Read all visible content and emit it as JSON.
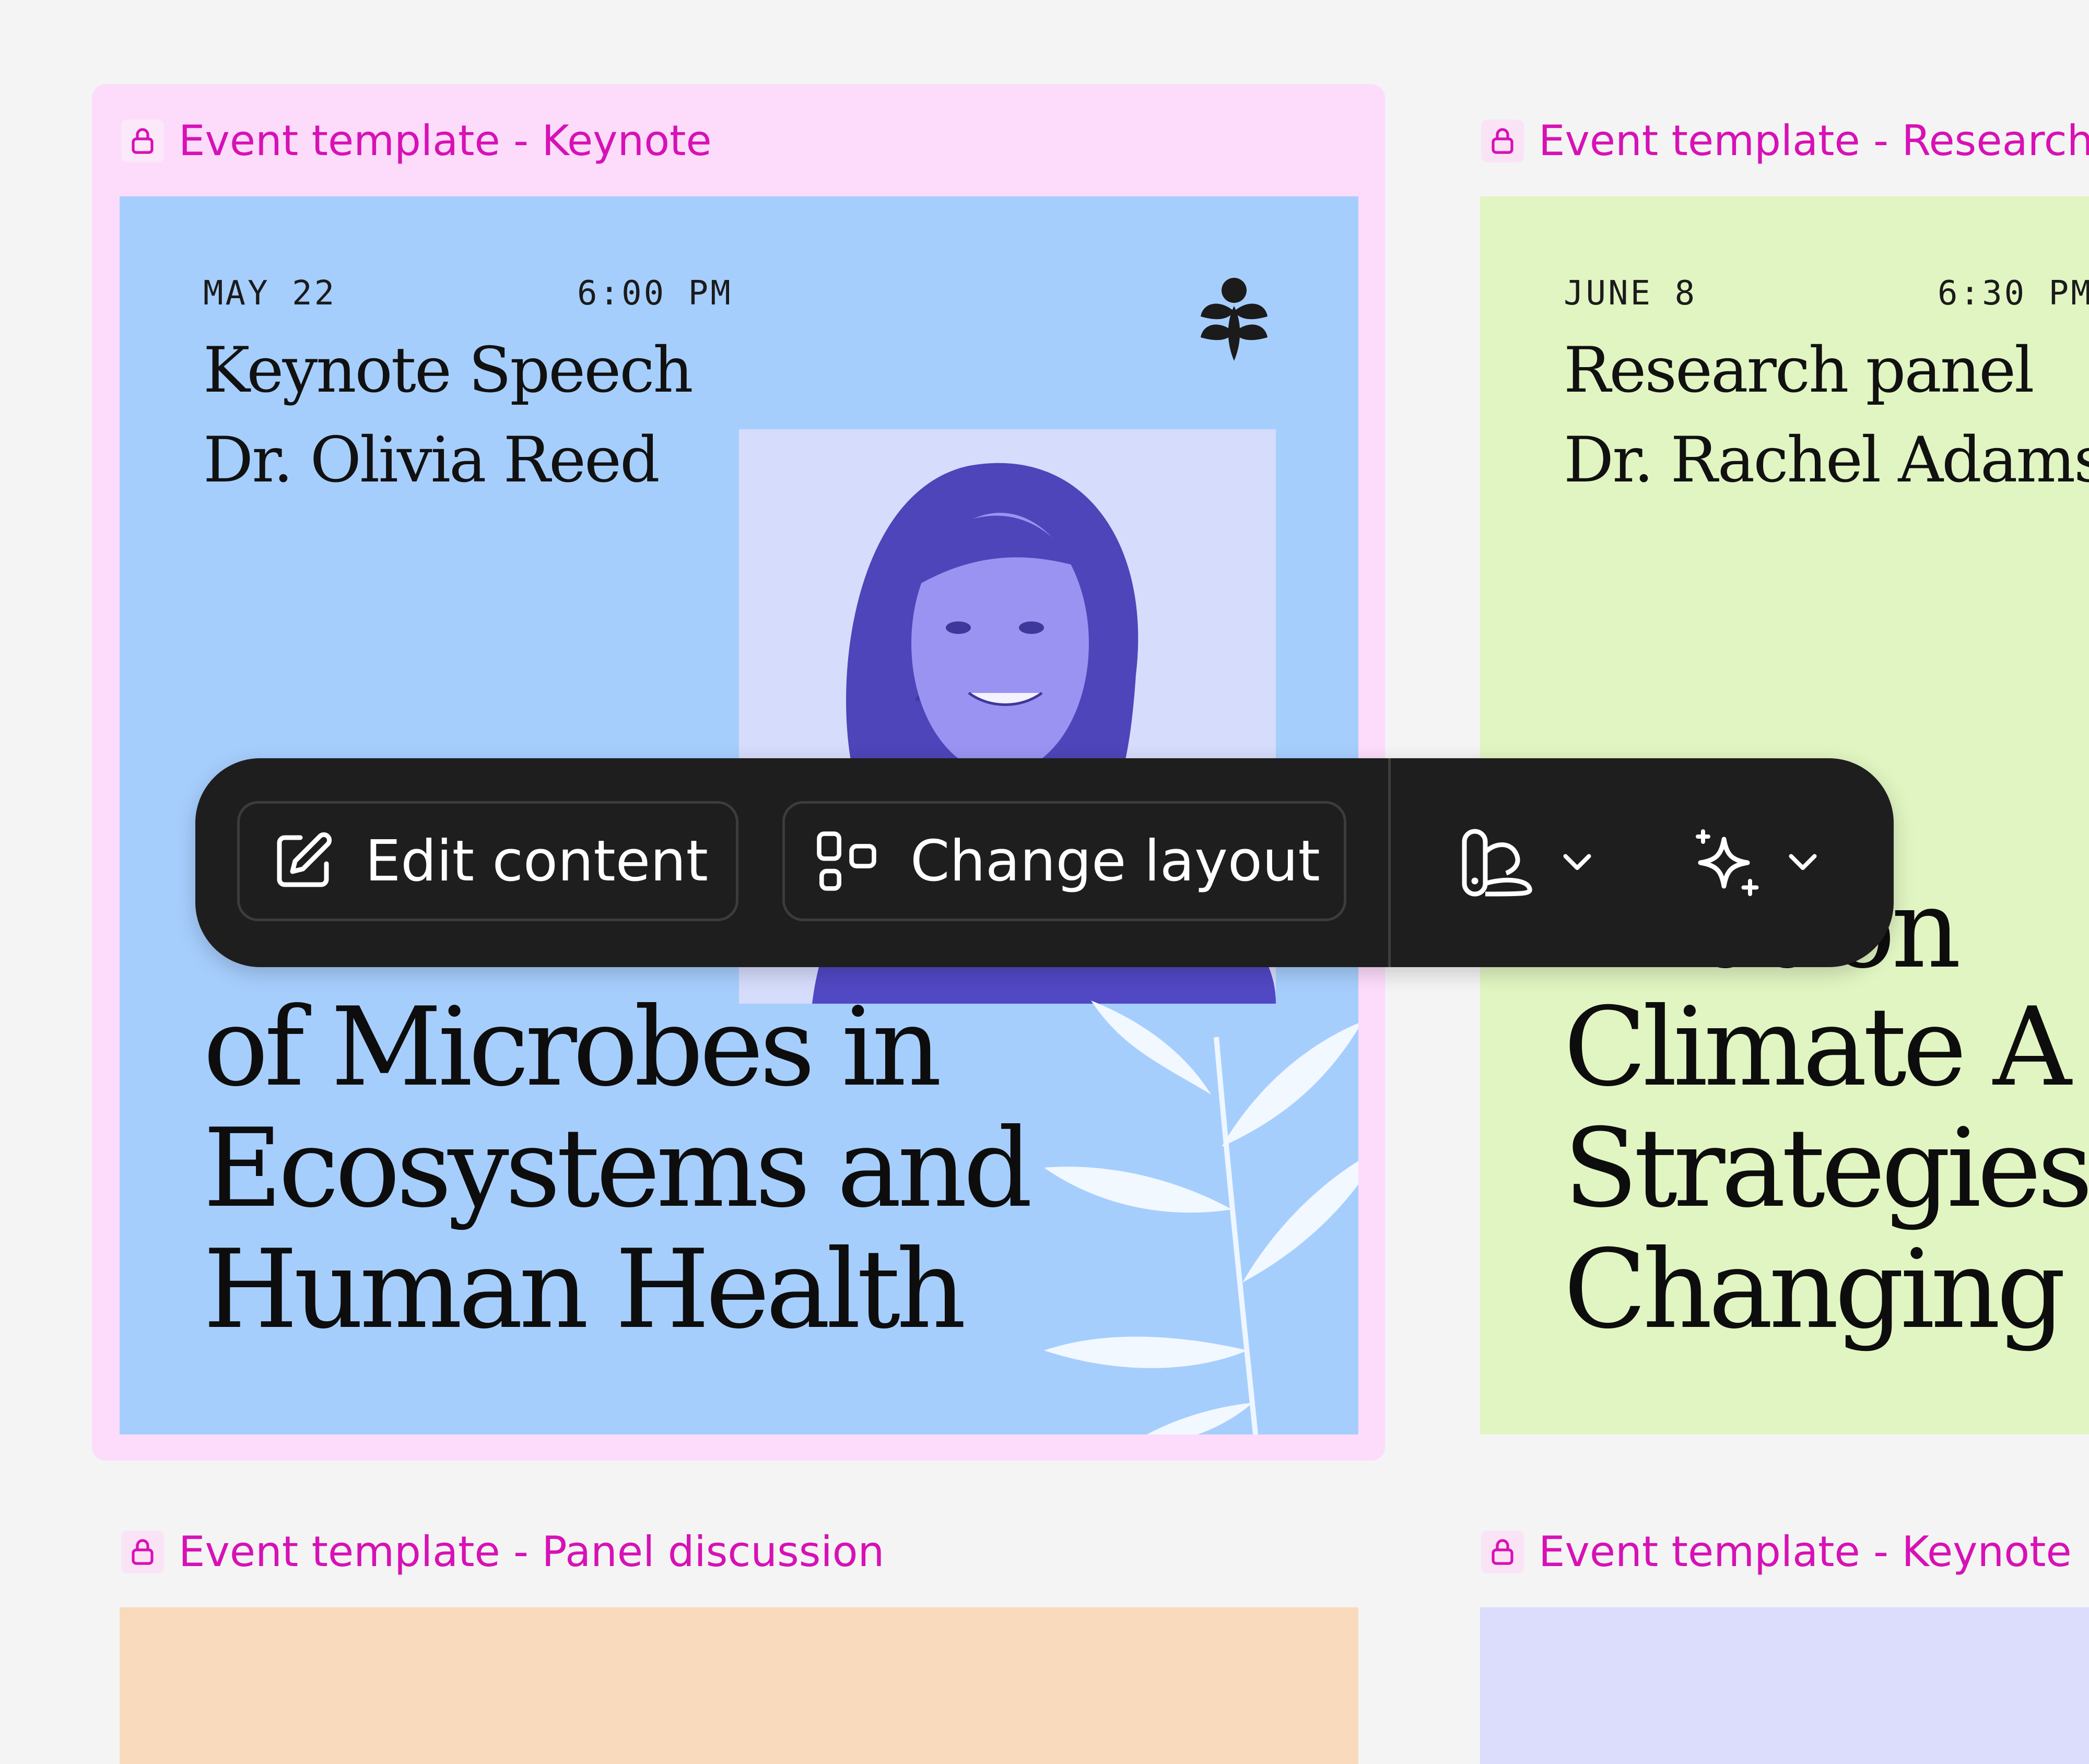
{
  "colors": {
    "canvas_bg": "#f4f4f4",
    "selected_frame_bg": "#fddcfb",
    "frame_label": "#d711b6",
    "keynote_card": "#a6cefd",
    "research_card": "#e1f5c2",
    "panel_card": "#f9dabc",
    "keynote2_card": "#dcdcfd",
    "toolbar_bg": "#1e1e1e"
  },
  "frames": [
    {
      "label": "Event template - Keynote",
      "lock_icon": "lock-icon",
      "card": {
        "date": "MAY 22",
        "time": "6:00 PM",
        "event_type": "Keynote Speech",
        "speaker": "Dr. Olivia Reed",
        "title_lines": [
          "of Microbes in",
          "Ecosystems and",
          "Human Health"
        ],
        "logo_icon": "leaf-logo-icon"
      }
    },
    {
      "label": "Event template - Research p",
      "lock_icon": "lock-icon",
      "card": {
        "date": "JUNE 8",
        "time": "6:30 PM",
        "event_type": "Research panel",
        "speaker": "Dr. Rachel Adams",
        "title_lines": [
          "ation",
          "Climate A",
          "Strategies f",
          "Changing F"
        ]
      }
    },
    {
      "label": "Event template - Panel discussion",
      "lock_icon": "lock-icon"
    },
    {
      "label": "Event template - Keynote",
      "lock_icon": "lock-icon"
    }
  ],
  "toolbar": {
    "edit_content_label": "Edit content",
    "change_layout_label": "Change layout",
    "edit_icon": "edit-square-pen-icon",
    "layout_icon": "layout-blocks-icon",
    "palette_icon": "shape-style-icon",
    "ai_icon": "sparkles-icon",
    "dropdown_icon": "chevron-down-icon"
  }
}
